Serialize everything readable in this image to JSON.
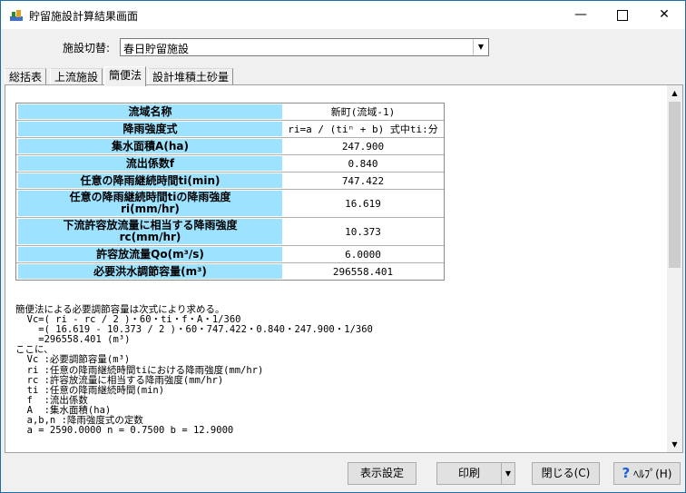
{
  "window": {
    "title": "貯留施設計算結果画面",
    "minimize_glyph": "—",
    "close_glyph": "✕"
  },
  "facility": {
    "label": "施設切替:",
    "selected": "春日貯留施設"
  },
  "tabs": [
    "総括表",
    "上流施設",
    "簡便法",
    "設計堆積土砂量"
  ],
  "active_tab": "簡便法",
  "table": {
    "rows": [
      {
        "label": "流域名称",
        "value": "新町(流域-1)"
      },
      {
        "label": "降雨強度式",
        "value": "ri=a / (tiⁿ + b) 式中ti:分"
      },
      {
        "label": "集水面積A(ha)",
        "value": "247.900"
      },
      {
        "label": "流出係数f",
        "value": "0.840"
      },
      {
        "label": "任意の降雨継続時間ti(min)",
        "value": "747.422"
      },
      {
        "label": "任意の降雨継続時間tiの降雨強度\nri(mm/hr)",
        "value": "16.619"
      },
      {
        "label": "下流許容放流量に相当する降雨強度\nrc(mm/hr)",
        "value": "10.373"
      },
      {
        "label": "許容放流量Qo(m³/s)",
        "value": "6.0000"
      },
      {
        "label": "必要洪水調節容量(m³)",
        "value": "296558.401"
      }
    ]
  },
  "explanation": {
    "lines": [
      "簡便法による必要調節容量は次式により求める。",
      "  Vc=( ri - rc / 2 )・60・ti・f・A・1/360",
      "    =( 16.619 - 10.373 / 2 )・60・747.422・0.840・247.900・1/360",
      "    =296558.401 (m³)",
      "ここに、",
      "  Vc :必要調節容量(m³)",
      "  ri :任意の降雨継続時間tiにおける降雨強度(mm/hr)",
      "  rc :許容放流量に相当する降雨強度(mm/hr)",
      "  ti :任意の降雨継続時間(min)",
      "  f  :流出係数",
      "  A  :集水面積(ha)",
      "  a,b,n :降雨強度式の定数",
      "  a = 2590.0000 n = 0.7500 b = 12.9000"
    ]
  },
  "buttons": {
    "display_settings": "表示設定",
    "print": "印刷",
    "close": "閉じる(C)",
    "help": "ﾍﾙﾌﾟ(H)",
    "help_glyph": "?"
  },
  "colors": {
    "label_cell": "#9de3ff",
    "help_icon": "#1a5fd1"
  }
}
